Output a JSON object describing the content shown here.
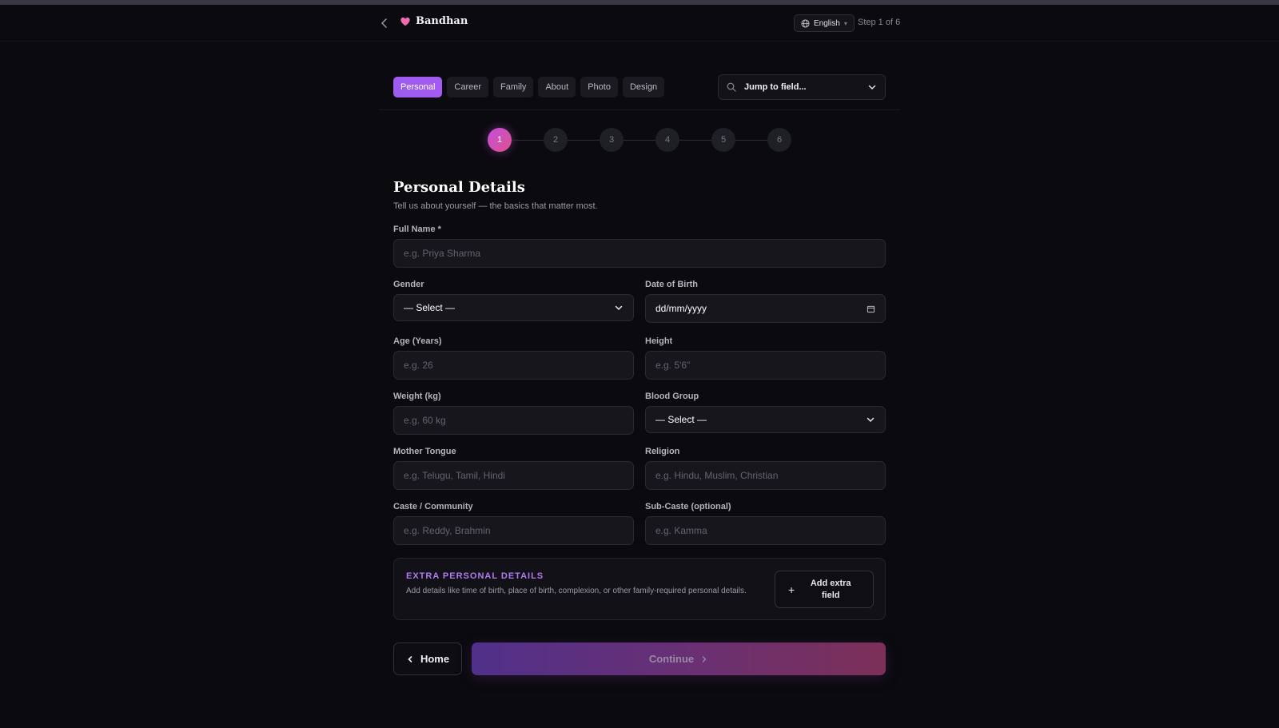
{
  "header": {
    "brand": "Bandhan",
    "language": "English",
    "step_indicator": "Step 1 of 6"
  },
  "tabs": [
    {
      "label": "Personal",
      "active": true
    },
    {
      "label": "Career"
    },
    {
      "label": "Family"
    },
    {
      "label": "About"
    },
    {
      "label": "Photo"
    },
    {
      "label": "Design"
    }
  ],
  "jump": {
    "label": "Jump to field..."
  },
  "stepper": [
    "1",
    "2",
    "3",
    "4",
    "5",
    "6"
  ],
  "section": {
    "title": "Personal Details",
    "subtitle": "Tell us about yourself — the basics that matter most."
  },
  "fields": {
    "full_name": {
      "label": "Full Name *",
      "placeholder": "e.g. Priya Sharma"
    },
    "gender": {
      "label": "Gender",
      "value": "— Select —"
    },
    "dob": {
      "label": "Date of Birth",
      "value": "dd/mm/yyyy"
    },
    "age": {
      "label": "Age (Years)",
      "placeholder": "e.g. 26"
    },
    "height": {
      "label": "Height",
      "placeholder": "e.g. 5'6\""
    },
    "weight": {
      "label": "Weight (kg)",
      "placeholder": "e.g. 60 kg"
    },
    "blood_group": {
      "label": "Blood Group",
      "value": "— Select —"
    },
    "mother_tongue": {
      "label": "Mother Tongue",
      "placeholder": "e.g. Telugu, Tamil, Hindi"
    },
    "religion": {
      "label": "Religion",
      "placeholder": "e.g. Hindu, Muslim, Christian"
    },
    "caste": {
      "label": "Caste / Community",
      "placeholder": "e.g. Reddy, Brahmin"
    },
    "sub_caste": {
      "label": "Sub-Caste (optional)",
      "placeholder": "e.g. Kamma"
    }
  },
  "extra": {
    "title": "EXTRA PERSONAL DETAILS",
    "description": "Add details like time of birth, place of birth, complexion, or other family-required personal details.",
    "button": "Add extra field"
  },
  "footer": {
    "home": "Home",
    "continue": "Continue"
  },
  "colors": {
    "accent": "#a55bef",
    "background": "#0a0a0f",
    "extra_title": "#b07cf0"
  }
}
